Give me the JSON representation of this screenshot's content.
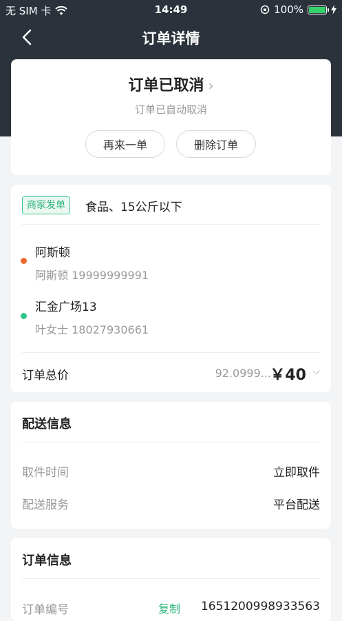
{
  "status_bar": {
    "carrier": "无 SIM 卡",
    "time": "14:49",
    "battery": "100%"
  },
  "nav": {
    "title": "订单详情",
    "back_icon": "chevron-left-icon"
  },
  "order_status": {
    "title": "订单已取消",
    "subtitle": "订单已自动取消",
    "buttons": {
      "reorder": "再来一单",
      "delete": "删除订单"
    }
  },
  "shipment": {
    "tag": "商家发单",
    "goods": "食品、15公斤以下",
    "sender": {
      "name": "阿斯顿",
      "contact": "阿斯顿 19999999991",
      "dot_color": "#ee6a2f"
    },
    "receiver": {
      "name": "汇金广场13",
      "contact": "叶女士 18027930661",
      "dot_color": "#2fc48a"
    },
    "total": {
      "label": "订单总价",
      "value": "92.0999...",
      "price": "￥40"
    }
  },
  "delivery": {
    "title": "配送信息",
    "rows": [
      {
        "label": "取件时间",
        "value": "立即取件"
      },
      {
        "label": "配送服务",
        "value": "平台配送"
      }
    ]
  },
  "order_info": {
    "title": "订单信息",
    "order_no_label": "订单编号",
    "copy": "复制",
    "order_no": "1651200998933563"
  },
  "colors": {
    "header": "#2b323b",
    "accent_green": "#2eb37c",
    "background": "#f3f4f6"
  }
}
